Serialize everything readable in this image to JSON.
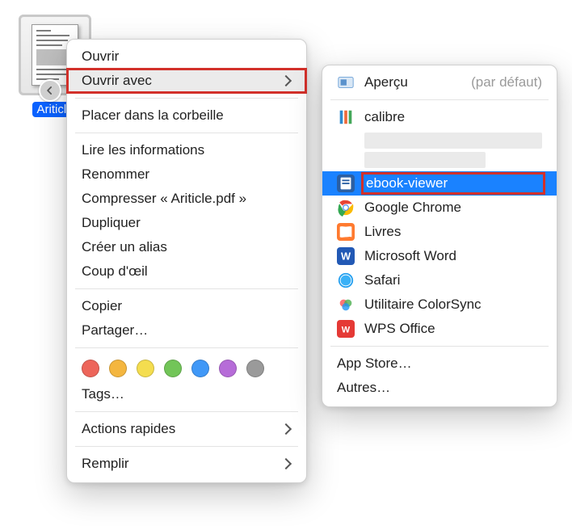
{
  "file": {
    "label": "Ariticle"
  },
  "primary_menu": {
    "items": {
      "open": "Ouvrir",
      "open_with": "Ouvrir avec",
      "trash": "Placer dans la corbeille",
      "get_info": "Lire les informations",
      "rename": "Renommer",
      "compress": "Compresser « Ariticle.pdf »",
      "duplicate": "Dupliquer",
      "make_alias": "Créer un alias",
      "quick_look": "Coup d'œil",
      "copy": "Copier",
      "share": "Partager…",
      "tags": "Tags…",
      "quick_actions": "Actions rapides",
      "fill": "Remplir"
    }
  },
  "tag_colors": [
    "#ed655a",
    "#f4b63f",
    "#f4dd4f",
    "#72c558",
    "#4098f7",
    "#b66cd8",
    "#9a9a9a"
  ],
  "secondary_menu": {
    "default_suffix": "(par défaut)",
    "apps": {
      "preview": "Aperçu",
      "calibre": "calibre",
      "ebook_viewer": "ebook-viewer",
      "chrome": "Google Chrome",
      "books": "Livres",
      "word": "Microsoft Word",
      "safari": "Safari",
      "colorsync": "Utilitaire ColorSync",
      "wps": "WPS Office"
    },
    "app_store": "App Store…",
    "others": "Autres…"
  }
}
